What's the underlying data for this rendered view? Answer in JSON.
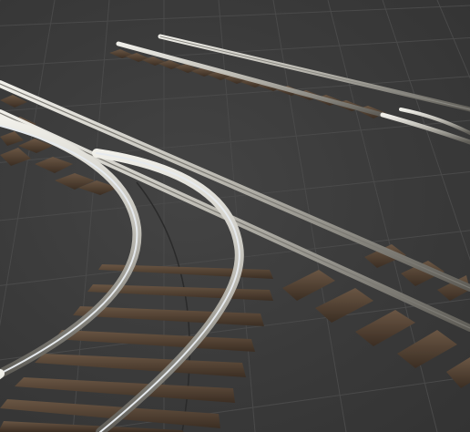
{
  "viewport": {
    "kind": "3d-viewport",
    "background_color": "#3a3a3a",
    "grid_color": "#4a4a4a",
    "grid": true
  },
  "scene": {
    "objects": [
      {
        "name": "straight-track-far",
        "type": "railroad-track",
        "shape": "straight",
        "rail_color": "#b8b6ae",
        "sleeper_color": "#4a3a2c"
      },
      {
        "name": "turnout-track-near",
        "type": "railroad-track",
        "shape": "turnout-switch",
        "rail_color": "#c9c8c3",
        "sleeper_color": "#4a3a2c"
      },
      {
        "name": "curved-track-near",
        "type": "railroad-track",
        "shape": "curve",
        "rail_color": "#cfd2d6",
        "sleeper_color": "#4d3e31"
      }
    ]
  }
}
